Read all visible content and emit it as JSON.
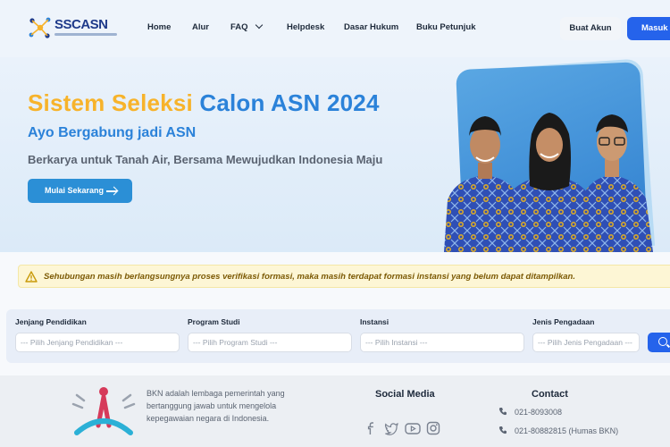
{
  "brand": {
    "logo_text_1": "SSC",
    "logo_text_2": "ASN"
  },
  "nav": {
    "items": [
      {
        "label": "Home"
      },
      {
        "label": "Alur"
      },
      {
        "label": "FAQ"
      },
      {
        "label": "Helpdesk"
      },
      {
        "label": "Dasar Hukum"
      },
      {
        "label": "Buku Petunjuk"
      }
    ],
    "buat_akun": "Buat Akun",
    "masuk": "Masuk"
  },
  "hero": {
    "title_part1": "Sistem Seleksi",
    "title_part2": "Calon ASN 2024",
    "subtitle": "Ayo Bergabung jadi ASN",
    "description": "Berkarya untuk Tanah Air, Bersama Mewujudkan Indonesia Maju",
    "cta": "Mulai Sekarang"
  },
  "alert": {
    "text": "Sehubungan masih berlangsungnya proses verifikasi formasi, maka masih terdapat formasi instansi yang belum dapat ditampilkan."
  },
  "filters": [
    {
      "label": "Jenjang Pendidikan",
      "placeholder": "--- Pilih Jenjang Pendidikan ---"
    },
    {
      "label": "Program Studi",
      "placeholder": "--- Pilih Program Studi ---"
    },
    {
      "label": "Instansi",
      "placeholder": "--- Pilih Instansi ---"
    },
    {
      "label": "Jenis Pengadaan",
      "placeholder": "--- Pilih Jenis Pengadaan ---"
    }
  ],
  "footer": {
    "about": "BKN adalah lembaga pemerintah yang bertanggung jawab untuk mengelola kepegawaian negara di Indonesia.",
    "social_title": "Social Media",
    "social_icons": [
      "facebook-icon",
      "twitter-icon",
      "youtube-icon",
      "instagram-icon"
    ],
    "contact_title": "Contact",
    "contacts": [
      "021-8093008",
      "021-80882815 (Humas BKN)"
    ]
  },
  "colors": {
    "primary": "#2563eb",
    "hero_yellow": "#f7b32b",
    "hero_blue": "#2b82d9",
    "alert_bg": "#fdf6d5"
  }
}
